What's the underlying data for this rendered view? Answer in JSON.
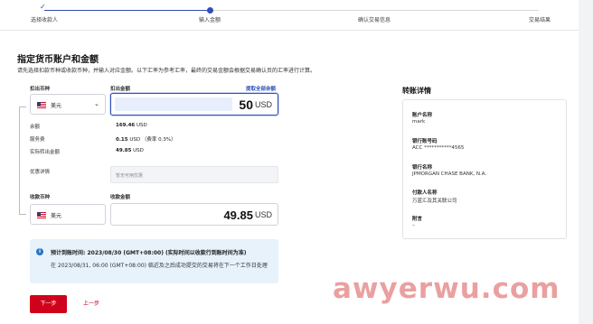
{
  "stepper": {
    "steps": [
      {
        "label": "选择收款人",
        "state": "done"
      },
      {
        "label": "输入金额",
        "state": "current"
      },
      {
        "label": "确认交易信息",
        "state": "todo"
      },
      {
        "label": "交易结果",
        "state": "todo"
      }
    ]
  },
  "header": {
    "title": "指定货币账户和金额",
    "subtitle": "请先选择扣款币种或收款币种，并输入对应金额。以下汇率为参考汇率，最终的交易金额会根据交易确认页的汇率进行计算。"
  },
  "form": {
    "debit_currency_label": "扣出币种",
    "debit_amount_label": "扣出金额",
    "exchange_all_link": "提取全部余额",
    "debit_currency_value": "美元",
    "debit_amount_value": "50",
    "debit_amount_currency": "USD",
    "details": [
      {
        "key": "余额",
        "value": "169.46",
        "unit": "USD",
        "extra": ""
      },
      {
        "key": "服务费",
        "value": "0.15",
        "unit": "USD",
        "extra": "（费率 0.3%）"
      },
      {
        "key": "实际转出金额",
        "value": "49.85",
        "unit": "USD",
        "extra": ""
      }
    ],
    "promo_label": "优惠详情",
    "promo_placeholder": "暂无可用优惠",
    "credit_currency_label": "收款币种",
    "credit_amount_label": "收款金额",
    "credit_currency_value": "美元",
    "credit_amount_value": "49.85",
    "credit_amount_currency": "USD"
  },
  "notice": {
    "icon": "info-icon",
    "title": "预计到账时间: 2023/08/30 (GMT+08:00) (实际时间以收款行到账时间为准)",
    "body": "在 2023/08/31, 06:00 (GMT+08:00) 临近及之后成功提交的交易将在下一个工作日处理"
  },
  "actions": {
    "next": "下一步",
    "prev": "上一步"
  },
  "transfer_details": {
    "title": "转账详情",
    "fields": [
      {
        "key": "账户名称",
        "value": "mark"
      },
      {
        "key": "银行账号码",
        "value": "ACC ***********4565"
      },
      {
        "key": "银行名称",
        "value": "JPMORGAN CHASE BANK, N.A."
      },
      {
        "key": "付款人名称",
        "value": "万蓝汇及其关联公司"
      },
      {
        "key": "附言",
        "value": "–"
      }
    ]
  },
  "watermark": "awyerwu.com",
  "colors": {
    "accent": "#2f4fb5",
    "primary_button": "#d0021b",
    "notice_bg": "#e7f2fb"
  }
}
